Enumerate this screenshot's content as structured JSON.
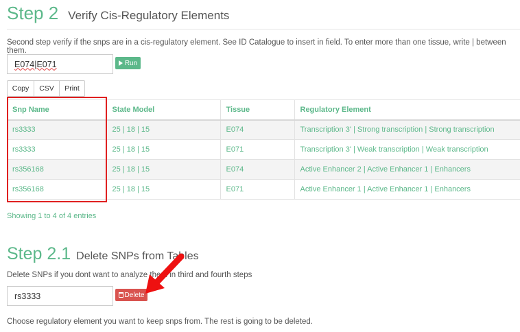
{
  "step2": {
    "number": "Step 2",
    "title": "Verify Cis-Regulatory Elements",
    "description": "Second step verify if the snps are in a cis-regulatory element. See ID Catalogue to insert in field. To enter more than one tissue, write | between them.",
    "tissue_input_value": "E074|E071",
    "run_label": "Run"
  },
  "export_buttons": {
    "copy": "Copy",
    "csv": "CSV",
    "print": "Print"
  },
  "table": {
    "headers": [
      "Snp Name",
      "State Model",
      "Tissue",
      "Regulatory Element"
    ],
    "rows": [
      [
        "rs3333",
        "25 | 18 | 15",
        "E074",
        "Transcription 3' | Strong transcription | Strong transcription"
      ],
      [
        "rs3333",
        "25 | 18 | 15",
        "E071",
        "Transcription 3' | Weak transcription | Weak transcription"
      ],
      [
        "rs356168",
        "25 | 18 | 15",
        "E074",
        "Active Enhancer 2 | Active Enhancer 1 | Enhancers"
      ],
      [
        "rs356168",
        "25 | 18 | 15",
        "E071",
        "Active Enhancer 1 | Active Enhancer 1 | Enhancers"
      ]
    ],
    "info": "Showing 1 to 4 of 4 entries"
  },
  "step21": {
    "number": "Step 2.1",
    "title": "Delete SNPs from Tables",
    "description": "Delete SNPs if you dont want to analyze them in third and fourth steps",
    "snp_input_value": "rs3333",
    "delete_label": "Delete",
    "next_description": "Choose regulatory element you want to keep snps from. The rest is going to be deleted."
  },
  "colors": {
    "accent": "#5cb88a",
    "danger": "#d9534f",
    "highlight": "#e02020"
  },
  "icons": {
    "run": "play-icon",
    "delete": "trash-icon",
    "annotation": "red-arrow-icon"
  }
}
